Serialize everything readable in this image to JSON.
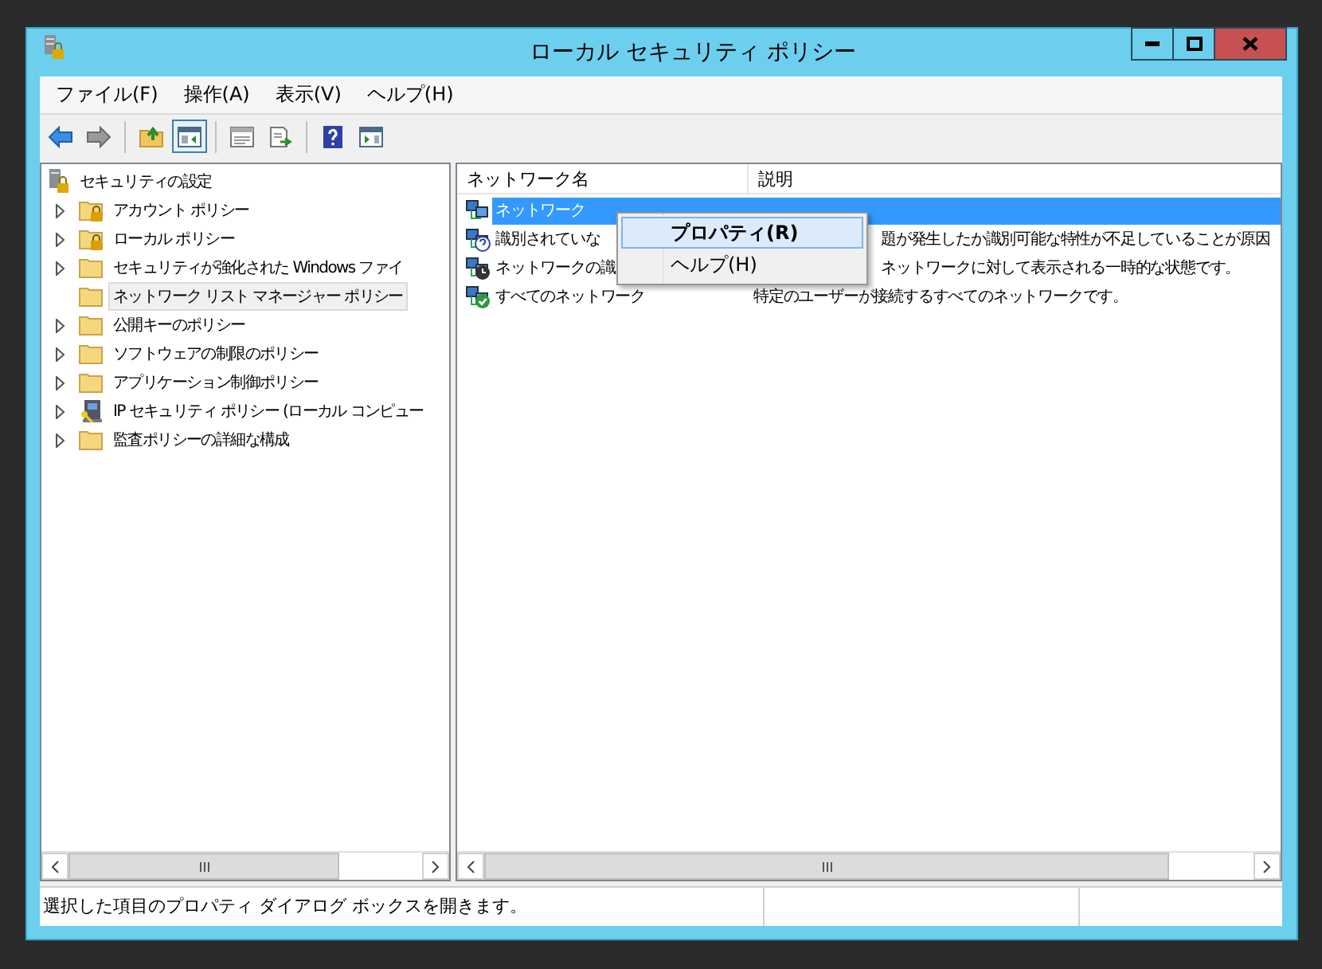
{
  "window": {
    "title": "ローカル セキュリティ ポリシー"
  },
  "menu_bar": [
    "ファイル(F)",
    "操作(A)",
    "表示(V)",
    "ヘルプ(H)"
  ],
  "toolbar": [
    {
      "kind": "back",
      "pressed": false
    },
    {
      "kind": "forward",
      "pressed": false
    },
    {
      "kind": "up",
      "pressed": false
    },
    {
      "kind": "tree",
      "pressed": true
    },
    {
      "kind": "properties",
      "pressed": false
    },
    {
      "kind": "export",
      "pressed": false
    },
    {
      "kind": "help",
      "pressed": false
    },
    {
      "kind": "action-pane",
      "pressed": false
    }
  ],
  "tree": {
    "root": "セキュリティの設定",
    "children": [
      {
        "label": "アカウント ポリシー",
        "kind": "locked-folder",
        "expandable": true,
        "selected": false
      },
      {
        "label": "ローカル ポリシー",
        "kind": "locked-folder",
        "expandable": true,
        "selected": false
      },
      {
        "label": "セキュリティが強化された Windows ファイ",
        "kind": "folder",
        "expandable": true,
        "selected": false
      },
      {
        "label": "ネットワーク リスト マネージャー ポリシー",
        "kind": "folder",
        "expandable": false,
        "selected": true
      },
      {
        "label": "公開キーのポリシー",
        "kind": "folder",
        "expandable": true,
        "selected": false
      },
      {
        "label": "ソフトウェアの制限のポリシー",
        "kind": "folder",
        "expandable": true,
        "selected": false
      },
      {
        "label": "アプリケーション制御ポリシー",
        "kind": "folder",
        "expandable": true,
        "selected": false
      },
      {
        "label": "IP セキュリティ ポリシー (ローカル コンピュー",
        "kind": "ip",
        "expandable": true,
        "selected": false
      },
      {
        "label": "監査ポリシーの詳細な構成",
        "kind": "folder",
        "expandable": true,
        "selected": false
      }
    ]
  },
  "list": {
    "columns": [
      "ネットワーク名",
      "説明"
    ],
    "rows": [
      {
        "name": "ネットワーク",
        "kind": "network",
        "selected": true
      },
      {
        "name": "識別されていな",
        "description": "題が発生したか識別可能な特性が不足していることが原因",
        "kind": "unknown",
        "selected": false,
        "partly_covered": true
      },
      {
        "name": "ネットワークの識",
        "description": "ネットワークに対して表示される一時的な状態です。",
        "kind": "pending",
        "selected": false,
        "partly_covered": true
      },
      {
        "name": "すべてのネットワーク",
        "description": "特定のユーザーが接続するすべてのネットワークです。",
        "kind": "all",
        "selected": false,
        "partly_covered": false
      }
    ]
  },
  "context_menu": [
    {
      "label": "プロパティ(R)",
      "default": true,
      "selected": true
    },
    {
      "label": "ヘルプ(H)",
      "default": false,
      "selected": false
    }
  ],
  "status_bar": {
    "text": "選択した項目のプロパティ ダイアログ ボックスを開きます。"
  }
}
